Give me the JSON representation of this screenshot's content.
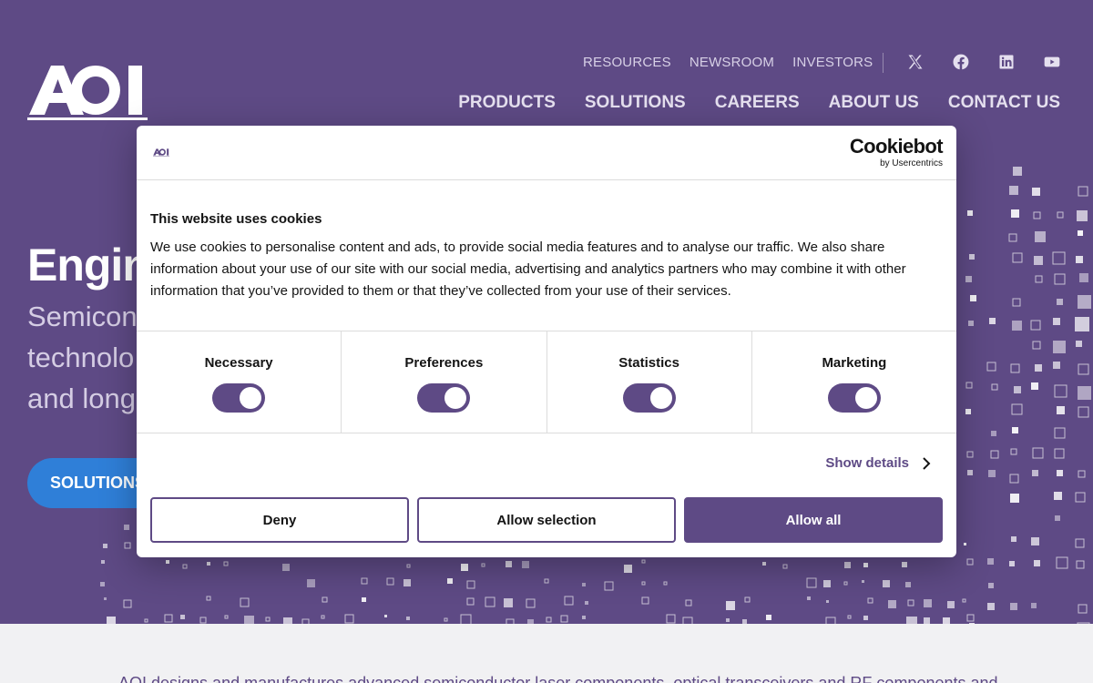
{
  "header": {
    "utility_nav": [
      "RESOURCES",
      "NEWSROOM",
      "INVESTORS"
    ],
    "social_icons": [
      "x-icon",
      "facebook-icon",
      "linkedin-icon",
      "youtube-icon"
    ],
    "main_nav": [
      "PRODUCTS",
      "SOLUTIONS",
      "CAREERS",
      "ABOUT US",
      "CONTACT US"
    ]
  },
  "hero": {
    "title": "Engin",
    "subtitle_lines": [
      "Semicon",
      "technolo",
      "and long"
    ],
    "cta": "SOLUTIONS"
  },
  "below_text": "AOI designs and manufactures advanced semiconductor laser components, optical transceivers and RF components and",
  "cookie_dialog": {
    "brand": "Cookiebot",
    "brand_sub": "by Usercentrics",
    "title": "This website uses cookies",
    "text": "We use cookies to personalise content and ads, to provide social media features and to analyse our traffic. We also share information about your use of our site with our social media, advertising and analytics partners who may combine it with other information that you’ve provided to them or that they’ve collected from your use of their services.",
    "categories": [
      "Necessary",
      "Preferences",
      "Statistics",
      "Marketing"
    ],
    "show_details": "Show details",
    "buttons": {
      "deny": "Deny",
      "allow_selection": "Allow selection",
      "allow_all": "Allow all"
    }
  },
  "colors": {
    "brand_purple": "#5e4a85",
    "cta_blue": "#2f7fd8",
    "white": "#ffffff"
  }
}
